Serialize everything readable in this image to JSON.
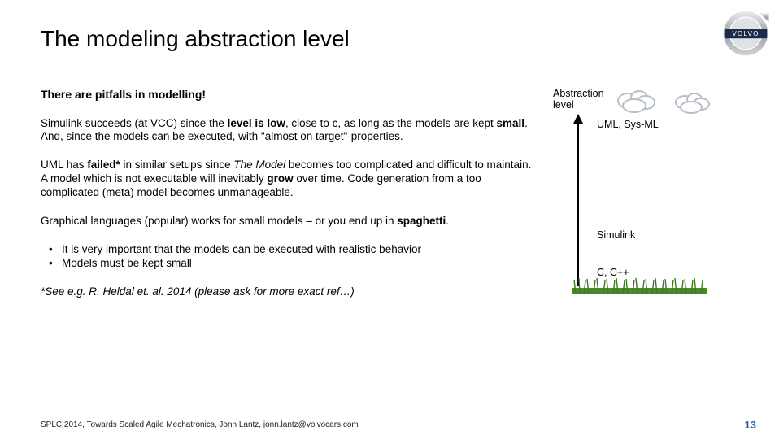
{
  "title": "The modeling abstraction level",
  "subhead": "There are pitfalls in modelling!",
  "para1": {
    "pre": "Simulink succeeds (at VCC) since the ",
    "emph1": "level is low",
    "mid1": ", close to c, as long as the models are kept ",
    "emph2": "small",
    "post": ". And, since the models can be executed, with \"almost on target\"-properties."
  },
  "para2": {
    "pre": "UML has ",
    "emph1": "failed*",
    "mid1": " in similar setups since ",
    "ital": "The Model",
    "mid2": " becomes too complicated and difficult to maintain. A model which is not executable will inevitably ",
    "emph2": "grow",
    "post": " over time. Code generation from a too complicated (meta) model becomes unmanageable."
  },
  "para3": {
    "pre": "Graphical languages (popular) works for small models – or you end up in ",
    "emph": "spaghetti",
    "post": "."
  },
  "bullet1": "It is very important that the models can be executed with realistic behavior",
  "bullet2": "Models must be kept small",
  "footnote": "*See e.g. R. Heldal et. al. 2014 (please ask for more exact ref…)",
  "axis_label_l1": "Abstraction",
  "axis_label_l2": "level",
  "label_uml": "UML, Sys-ML",
  "label_simulink": "Simulink",
  "label_c": "C, C++",
  "footer": "SPLC 2014, Towards Scaled Agile Mechatronics, Jonn Lantz, jonn.lantz@volvocars.com",
  "pagenum": "13",
  "logo_text": "VOLVO"
}
